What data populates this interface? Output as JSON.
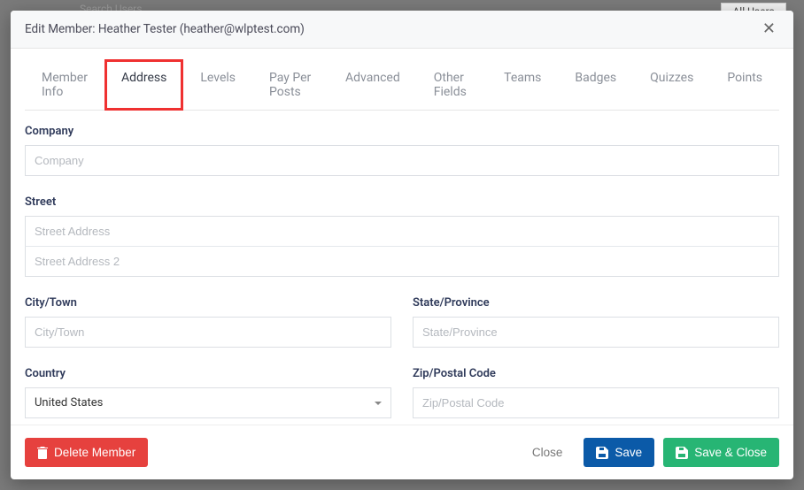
{
  "background": {
    "search_hint": "Search Users",
    "filter_hint": "- All Users -"
  },
  "header": {
    "title": "Edit Member: Heather Tester (heather@wlptest.com)"
  },
  "tabs": [
    {
      "label": "Member Info",
      "active": false
    },
    {
      "label": "Address",
      "active": true
    },
    {
      "label": "Levels",
      "active": false
    },
    {
      "label": "Pay Per Posts",
      "active": false
    },
    {
      "label": "Advanced",
      "active": false
    },
    {
      "label": "Other Fields",
      "active": false
    },
    {
      "label": "Teams",
      "active": false
    },
    {
      "label": "Badges",
      "active": false
    },
    {
      "label": "Quizzes",
      "active": false
    },
    {
      "label": "Points",
      "active": false
    }
  ],
  "form": {
    "company": {
      "label": "Company",
      "placeholder": "Company",
      "value": ""
    },
    "street": {
      "label": "Street",
      "placeholder1": "Street Address",
      "placeholder2": "Street Address 2",
      "value1": "",
      "value2": ""
    },
    "city": {
      "label": "City/Town",
      "placeholder": "City/Town",
      "value": ""
    },
    "state": {
      "label": "State/Province",
      "placeholder": "State/Province",
      "value": ""
    },
    "country": {
      "label": "Country",
      "selected": "United States"
    },
    "zip": {
      "label": "Zip/Postal Code",
      "placeholder": "Zip/Postal Code",
      "value": ""
    }
  },
  "footer": {
    "delete": "Delete Member",
    "close": "Close",
    "save": "Save",
    "save_close": "Save & Close"
  }
}
